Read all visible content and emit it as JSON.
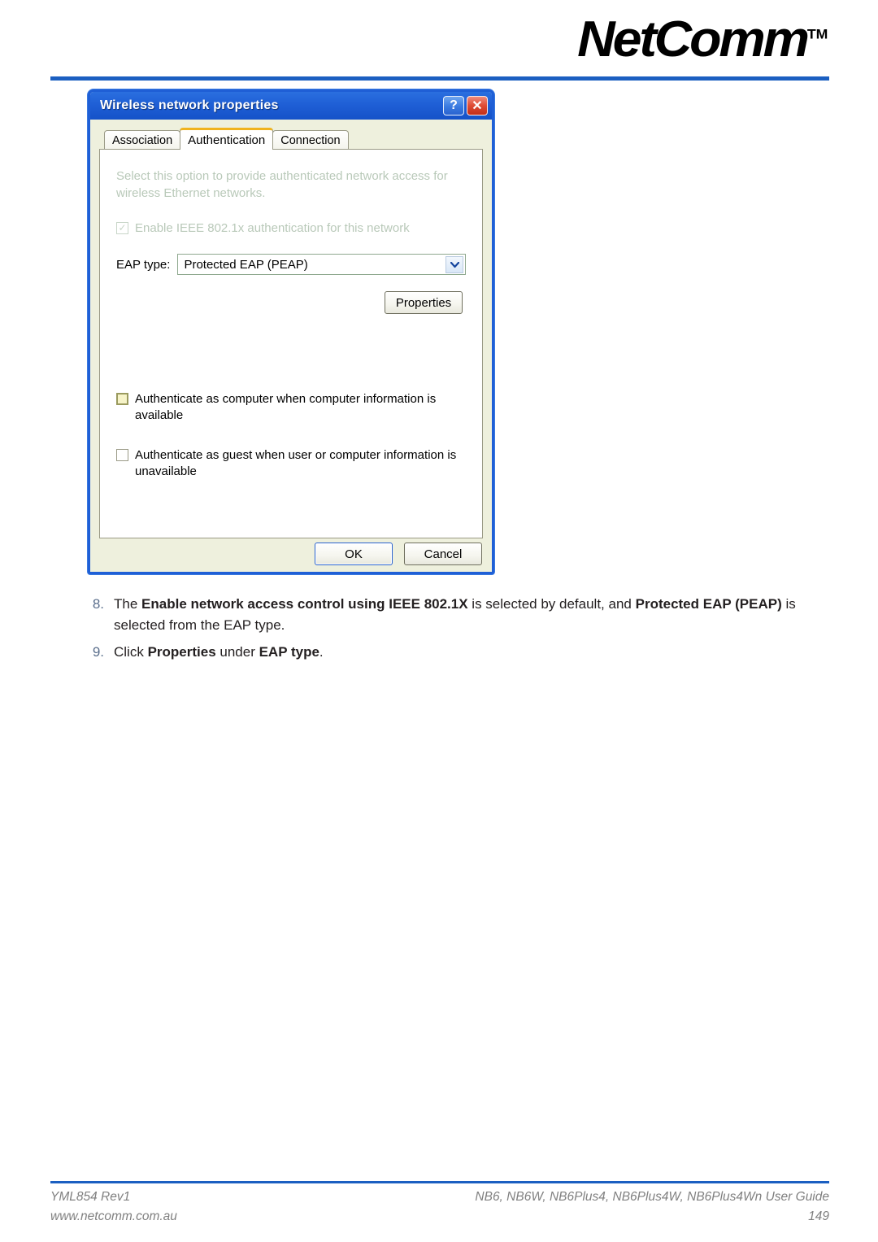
{
  "header": {
    "brand": "NetComm",
    "trademark": "TM",
    "rule_color": "#1b5fc1"
  },
  "dialog": {
    "title": "Wireless network properties",
    "help_button": "?",
    "close_button": "✕",
    "tabs": [
      {
        "label": "Association",
        "active": false
      },
      {
        "label": "Authentication",
        "active": true
      },
      {
        "label": "Connection",
        "active": false
      }
    ],
    "description": "Select this option to provide authenticated network access for wireless Ethernet networks.",
    "enable_8021x": {
      "label": "Enable IEEE 802.1x authentication for this network",
      "checked": true,
      "disabled": true,
      "mark": "✓"
    },
    "eap_type": {
      "label": "EAP type:",
      "value": "Protected EAP (PEAP)",
      "arrow": "❯"
    },
    "properties_button": "Properties",
    "checkboxes": [
      {
        "label": "Authenticate as computer when computer information is available",
        "checked": false,
        "highlighted": true
      },
      {
        "label": "Authenticate as guest when user or computer information is unavailable",
        "checked": false,
        "highlighted": false
      }
    ],
    "ok_button": "OK",
    "cancel_button": "Cancel",
    "accent_active_tab": "#f0b31e",
    "titlebar_color": "#1f5fd6"
  },
  "steps": [
    {
      "number": "8.",
      "segments": [
        {
          "text": "The ",
          "bold": false
        },
        {
          "text": "Enable network access control using IEEE 802.1X",
          "bold": true
        },
        {
          "text": " is selected by default, and ",
          "bold": false
        },
        {
          "text": "Protected EAP (PEAP)",
          "bold": true
        },
        {
          "text": " is selected from the EAP type.",
          "bold": false
        }
      ]
    },
    {
      "number": "9.",
      "segments": [
        {
          "text": "Click ",
          "bold": false
        },
        {
          "text": "Properties",
          "bold": true
        },
        {
          "text": " under ",
          "bold": false
        },
        {
          "text": "EAP type",
          "bold": true
        },
        {
          "text": ".",
          "bold": false
        }
      ]
    }
  ],
  "footer": {
    "left_line1": "YML854 Rev1",
    "left_line2": "www.netcomm.com.au",
    "right_line1": "NB6, NB6W, NB6Plus4, NB6Plus4W, NB6Plus4Wn User Guide",
    "right_line2": "149"
  }
}
